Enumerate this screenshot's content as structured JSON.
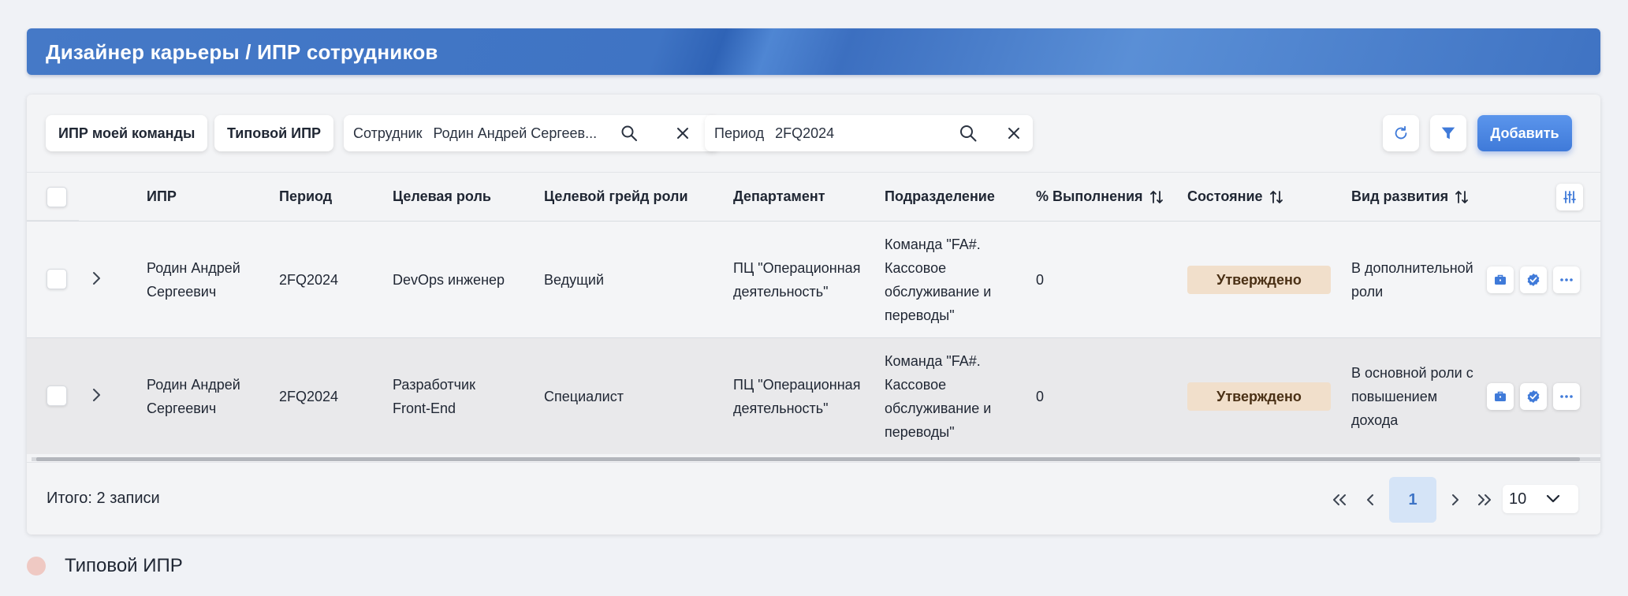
{
  "header": {
    "title": "Дизайнер карьеры / ИПР сотрудников"
  },
  "toolbar": {
    "team_button": "ИПР моей команды",
    "typical_button": "Типовой ИПР",
    "employee_filter": {
      "label": "Сотрудник",
      "value": "Родин Андрей Сергеев..."
    },
    "period_filter": {
      "label": "Период",
      "value": "2FQ2024"
    },
    "add_button": "Добавить"
  },
  "table": {
    "columns": {
      "ipr": "ИПР",
      "period": "Период",
      "target_role": "Целевая роль",
      "target_grade": "Целевой грейд роли",
      "department": "Департамент",
      "division": "Подразделение",
      "completion": "% Выполнения",
      "state": "Состояние",
      "dev_type": "Вид развития"
    },
    "rows": [
      {
        "ipr_line1": "Родин Андрей",
        "ipr_line2": "Сергеевич",
        "period": "2FQ2024",
        "role_line1": "DevOps инженер",
        "role_line2": "",
        "grade": "Ведущий",
        "dept_line1": "ПЦ \"Операционная",
        "dept_line2": "деятельность\"",
        "div_line1": "Команда \"FA#.",
        "div_line2": "Кассовое",
        "div_line3": "обслуживание и",
        "div_line4": "переводы\"",
        "completion": "0",
        "state": "Утверждено",
        "dev_line1": "В дополнительной",
        "dev_line2": "роли",
        "dev_line3": ""
      },
      {
        "ipr_line1": "Родин Андрей",
        "ipr_line2": "Сергеевич",
        "period": "2FQ2024",
        "role_line1": "Разработчик",
        "role_line2": "Front-End",
        "grade": "Специалист",
        "dept_line1": "ПЦ \"Операционная",
        "dept_line2": "деятельность\"",
        "div_line1": "Команда \"FA#.",
        "div_line2": "Кассовое",
        "div_line3": "обслуживание и",
        "div_line4": "переводы\"",
        "completion": "0",
        "state": "Утверждено",
        "dev_line1": "В основной роли с",
        "dev_line2": "повышением",
        "dev_line3": "дохода"
      }
    ]
  },
  "footer": {
    "total": "Итого: 2 записи",
    "current_page": "1",
    "page_size": "10"
  },
  "legend": {
    "label": "Типовой ИПР",
    "color": "#efc9c3"
  },
  "colors": {
    "accent": "#3f7ad9",
    "badge_bg": "#f1dfcb",
    "header_bg": "#4579c7"
  }
}
